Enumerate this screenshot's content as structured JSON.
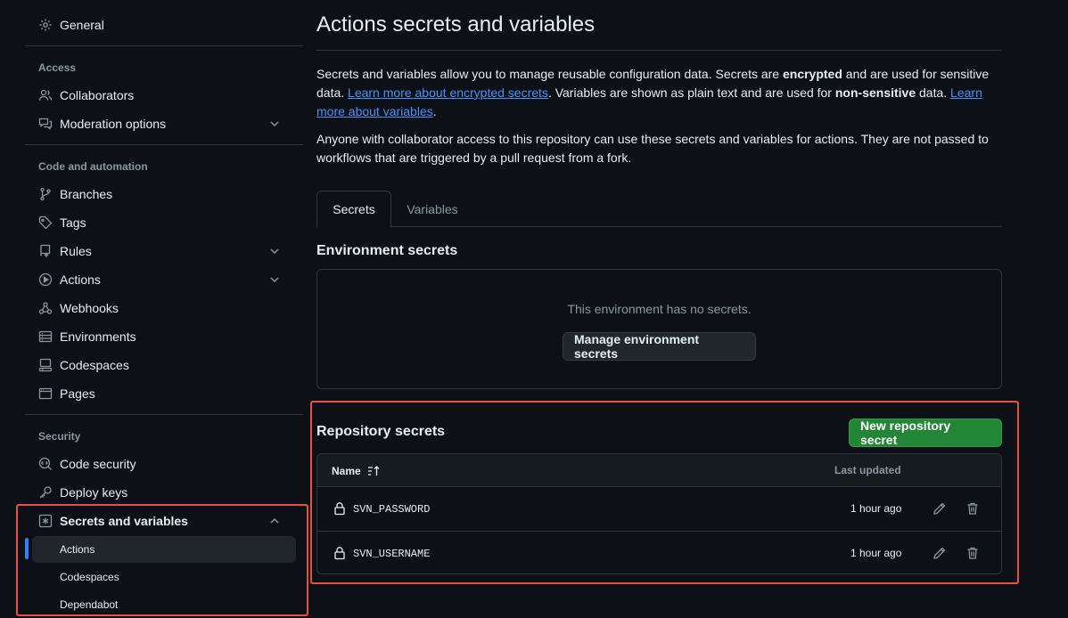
{
  "sidebar": {
    "general": "General",
    "sections": {
      "access": "Access",
      "code_automation": "Code and automation",
      "security": "Security"
    },
    "items": {
      "collaborators": "Collaborators",
      "moderation": "Moderation options",
      "branches": "Branches",
      "tags": "Tags",
      "rules": "Rules",
      "actions": "Actions",
      "webhooks": "Webhooks",
      "environments": "Environments",
      "codespaces": "Codespaces",
      "pages": "Pages",
      "code_security": "Code security",
      "deploy_keys": "Deploy keys",
      "secrets_variables": "Secrets and variables"
    },
    "sub_items": {
      "actions": "Actions",
      "codespaces": "Codespaces",
      "dependabot": "Dependabot"
    }
  },
  "main": {
    "title": "Actions secrets and variables",
    "intro": {
      "p1_a": "Secrets and variables allow you to manage reusable configuration data. Secrets are ",
      "p1_b": "encrypted",
      "p1_c": " and are used for sensitive data. ",
      "p1_link1": "Learn more about encrypted secrets",
      "p1_d": ". Variables are shown as plain text and are used for ",
      "p1_e": "non-sensitive",
      "p1_f": " data. ",
      "p1_link2": "Learn more about variables",
      "p1_g": ".",
      "p2": "Anyone with collaborator access to this repository can use these secrets and variables for actions. They are not passed to workflows that are triggered by a pull request from a fork."
    },
    "tabs": {
      "secrets": "Secrets",
      "variables": "Variables"
    },
    "environment": {
      "heading": "Environment secrets",
      "empty_text": "This environment has no secrets.",
      "manage_button": "Manage environment secrets"
    },
    "repository": {
      "heading": "Repository secrets",
      "new_button": "New repository secret",
      "columns": {
        "name": "Name",
        "last_updated": "Last updated"
      },
      "rows": [
        {
          "name": "SVN_PASSWORD",
          "updated": "1 hour ago"
        },
        {
          "name": "SVN_USERNAME",
          "updated": "1 hour ago"
        }
      ]
    }
  },
  "colors": {
    "background": "#0d1117",
    "border": "#30363d",
    "accent_blue": "#2f81f7",
    "link": "#4493f8",
    "primary_green": "#238636",
    "highlight_red": "#e5533a"
  }
}
